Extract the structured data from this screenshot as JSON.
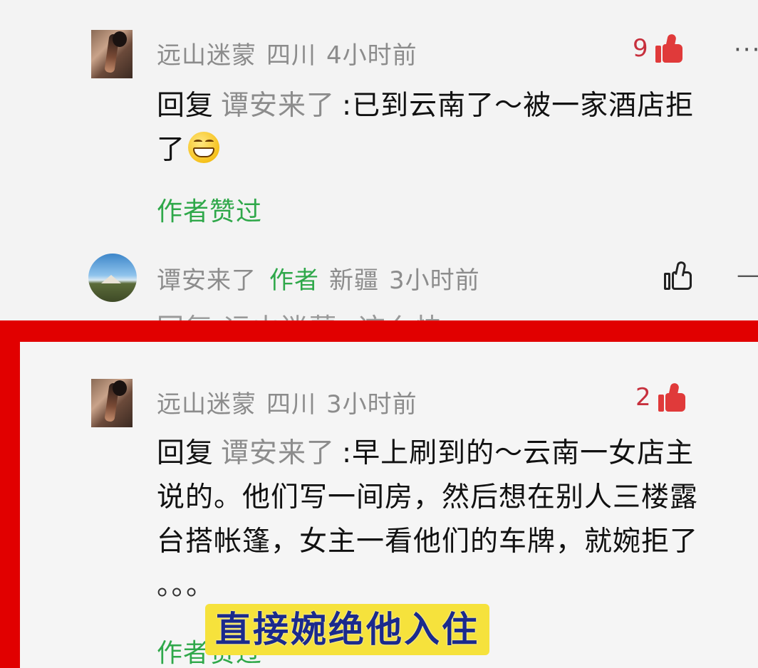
{
  "comments": [
    {
      "user": "远山迷蒙",
      "region": "四川",
      "time": "4小时前",
      "likes": "9",
      "reply_prefix": "回复",
      "reply_to": "谭安来了",
      "text_line1": ":已到云南了～被一家酒店拒",
      "text_line2": "了",
      "author_liked": "作者赞过"
    },
    {
      "user": "谭安来了",
      "author_tag": "作者",
      "region": "新疆",
      "time": "3小时前",
      "peek_text": "回复 远山迷蒙 :这么快"
    },
    {
      "user": "远山迷蒙",
      "region": "四川",
      "time": "3小时前",
      "likes": "2",
      "reply_prefix": "回复",
      "reply_to": "谭安来了",
      "text_line1": ":早上刷到的～云南一女店主",
      "text_line2": "说的。他们写一间房，然后想在别人三楼露",
      "text_line3": "台搭帐篷，女主一看他们的车牌，就婉拒了",
      "text_line4": "。。。",
      "author_liked": "作者赞过"
    }
  ],
  "more_icon": "···",
  "caption": "直接婉绝他入住",
  "colors": {
    "frame": "#e10000",
    "author_green": "#2fa84a",
    "like_red": "#e03a3a",
    "caption_bg": "#f6e23c",
    "caption_text": "#1b2a8c"
  }
}
